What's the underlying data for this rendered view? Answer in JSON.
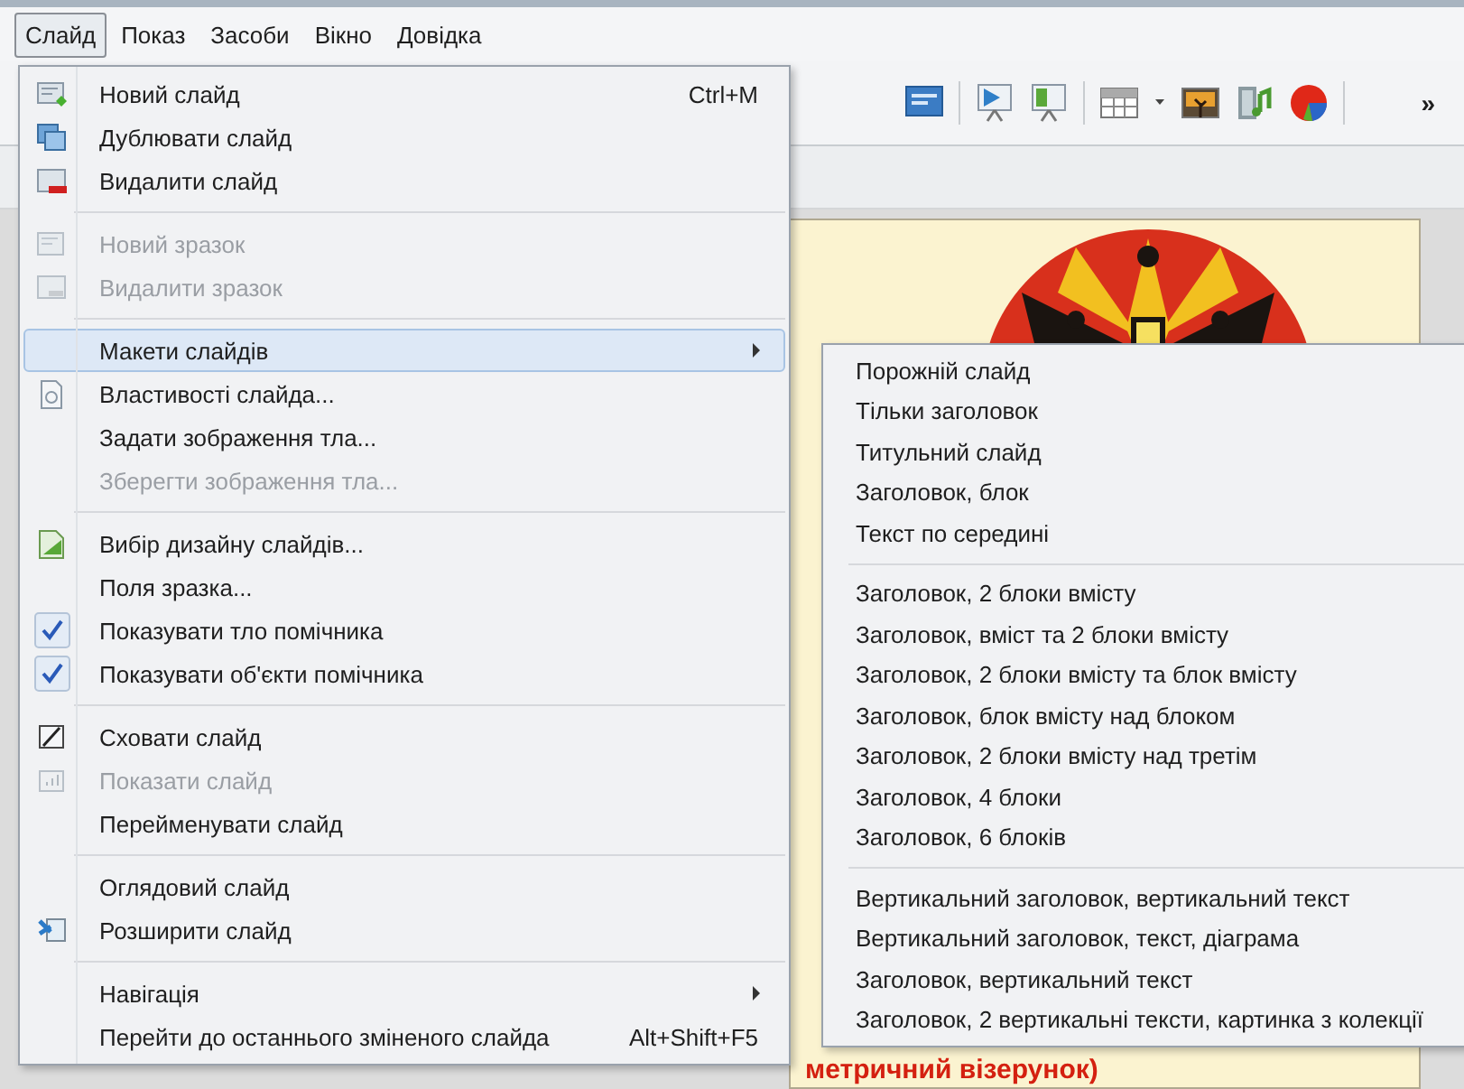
{
  "menubar": [
    {
      "label": "Слайд",
      "selected": true
    },
    {
      "label": "Показ",
      "selected": false
    },
    {
      "label": "Засоби",
      "selected": false
    },
    {
      "label": "Вікно",
      "selected": false
    },
    {
      "label": "Довідка",
      "selected": false
    }
  ],
  "toolbar": {
    "overflow": "»"
  },
  "slide": {
    "caption": "метричний візерунок)"
  },
  "main_menu": {
    "groups": [
      [
        {
          "label": "Новий слайд",
          "shortcut": "Ctrl+M",
          "disabled": false,
          "selected": false,
          "checked": false,
          "submenu": false
        },
        {
          "label": "Дублювати слайд",
          "disabled": false,
          "selected": false,
          "checked": false,
          "submenu": false
        },
        {
          "label": "Видалити слайд",
          "disabled": false,
          "selected": false,
          "checked": false,
          "submenu": false
        }
      ],
      [
        {
          "label": "Новий зразок",
          "disabled": true,
          "selected": false,
          "checked": false,
          "submenu": false
        },
        {
          "label": "Видалити зразок",
          "disabled": true,
          "selected": false,
          "checked": false,
          "submenu": false
        }
      ],
      [
        {
          "label": "Макети слайдів",
          "disabled": false,
          "selected": true,
          "checked": false,
          "submenu": true
        },
        {
          "label": "Властивості слайда...",
          "disabled": false,
          "selected": false,
          "checked": false,
          "submenu": false
        },
        {
          "label": "Задати зображення тла...",
          "disabled": false,
          "selected": false,
          "checked": false,
          "submenu": false
        },
        {
          "label": "Зберегти зображення тла...",
          "disabled": true,
          "selected": false,
          "checked": false,
          "submenu": false
        }
      ],
      [
        {
          "label": "Вибір дизайну слайдів...",
          "disabled": false,
          "selected": false,
          "checked": false,
          "submenu": false
        },
        {
          "label": "Поля зразка...",
          "disabled": false,
          "selected": false,
          "checked": false,
          "submenu": false
        },
        {
          "label": "Показувати тло помічника",
          "disabled": false,
          "selected": false,
          "checked": true,
          "submenu": false
        },
        {
          "label": "Показувати об'єкти помічника",
          "disabled": false,
          "selected": false,
          "checked": true,
          "submenu": false
        }
      ],
      [
        {
          "label": "Сховати слайд",
          "disabled": false,
          "selected": false,
          "checked": false,
          "submenu": false
        },
        {
          "label": "Показати слайд",
          "disabled": true,
          "selected": false,
          "checked": false,
          "submenu": false
        },
        {
          "label": "Перейменувати слайд",
          "disabled": false,
          "selected": false,
          "checked": false,
          "submenu": false
        }
      ],
      [
        {
          "label": "Оглядовий слайд",
          "disabled": false,
          "selected": false,
          "checked": false,
          "submenu": false
        },
        {
          "label": "Розширити слайд",
          "disabled": false,
          "selected": false,
          "checked": false,
          "submenu": false
        }
      ],
      [
        {
          "label": "Навігація",
          "disabled": false,
          "selected": false,
          "checked": false,
          "submenu": true
        },
        {
          "label": "Перейти до останнього зміненого слайда",
          "shortcut": "Alt+Shift+F5",
          "disabled": false,
          "selected": false,
          "checked": false,
          "submenu": false
        }
      ]
    ]
  },
  "layouts_submenu": {
    "groups": [
      [
        "Порожній слайд",
        "Тільки заголовок",
        "Титульний слайд",
        "Заголовок, блок",
        "Текст по середині"
      ],
      [
        "Заголовок, 2 блоки вмісту",
        "Заголовок, вміст та 2 блоки вмісту",
        "Заголовок, 2 блоки вмісту та блок вмісту",
        "Заголовок, блок вмісту над блоком",
        "Заголовок, 2 блоки вмісту над третім",
        "Заголовок, 4 блоки",
        "Заголовок, 6 блоків"
      ],
      [
        "Вертикальний заголовок, вертикальний текст",
        "Вертикальний заголовок, текст, діаграма",
        "Заголовок, вертикальний текст",
        "Заголовок, 2 вертикальні тексти, картинка з колекції"
      ]
    ]
  }
}
